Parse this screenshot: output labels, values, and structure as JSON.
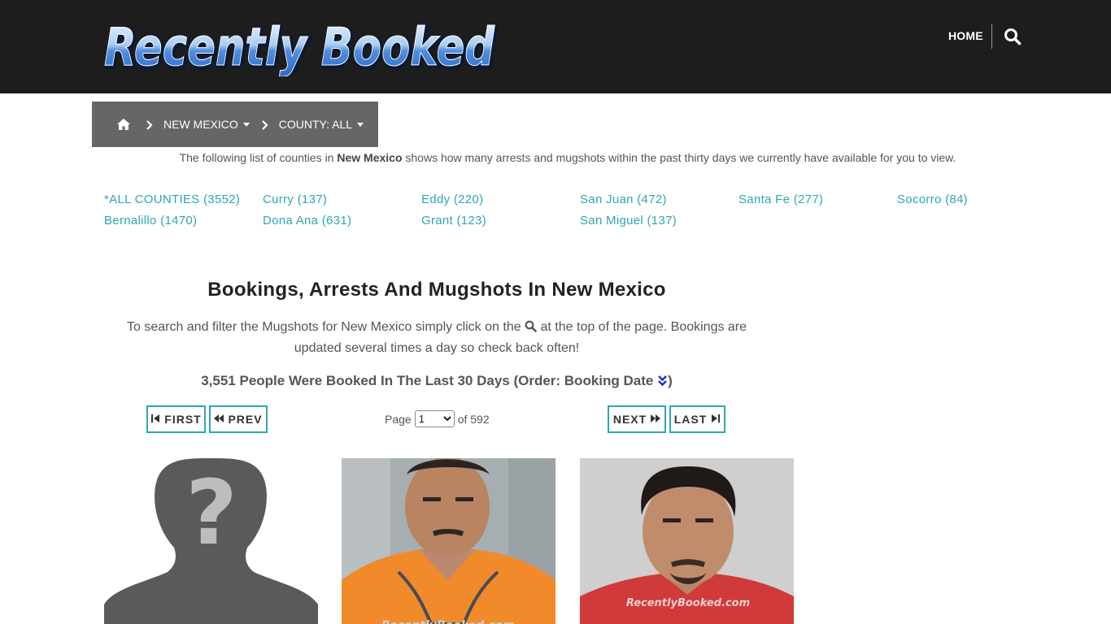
{
  "header": {
    "logo_text": "Recently Booked",
    "nav_home": "HOME"
  },
  "breadcrumb": {
    "state": "NEW MEXICO",
    "county": "COUNTY: ALL"
  },
  "intro": {
    "before": "The following list of counties in ",
    "state": "New Mexico",
    "after": " shows how many arrests and mugshots within the past thirty days we currently have available for you to view."
  },
  "counties": [
    "*ALL COUNTIES (3552)",
    "Curry (137)",
    "Eddy (220)",
    "San Juan (472)",
    "Santa Fe (277)",
    "Socorro (84)",
    "Bernalillo (1470)",
    "Dona Ana (631)",
    "Grant (123)",
    "San Miguel (137)"
  ],
  "main": {
    "title": "Bookings, Arrests And Mugshots In New Mexico",
    "help_before": "To search and filter the Mugshots for New Mexico simply click on the",
    "help_after": "at the top of the page. Bookings are updated several times a day so check back often!",
    "count_text": "3,551 People Were Booked In The Last 30 Days (Order: Booking Date",
    "count_close": ")"
  },
  "pagination": {
    "first": "FIRST",
    "prev": "PREV",
    "next": "NEXT",
    "last": "LAST",
    "page_label": "Page",
    "page_value": "1",
    "of_label": "of 592"
  },
  "mugshots": {
    "watermark": "RecentlyBooked.com"
  },
  "colors": {
    "header_bg": "#1d1d1d",
    "accent": "#2fa7b0",
    "breadcrumb_bg": "#666666"
  }
}
